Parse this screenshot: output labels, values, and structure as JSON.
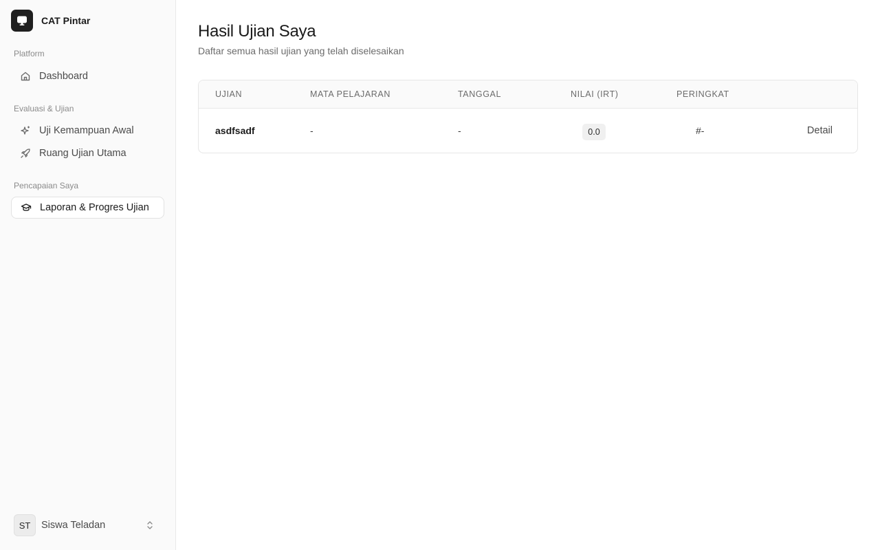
{
  "app": {
    "name": "CAT Pintar"
  },
  "sidebar": {
    "sections": [
      {
        "label": "Platform"
      },
      {
        "label": "Evaluasi & Ujian"
      },
      {
        "label": "Pencapaian Saya"
      }
    ],
    "items": [
      {
        "label": "Dashboard",
        "icon": "home-icon"
      },
      {
        "label": "Uji Kemampuan Awal",
        "icon": "sparkles-icon"
      },
      {
        "label": "Ruang Ujian Utama",
        "icon": "rocket-icon"
      },
      {
        "label": "Laporan & Progres Ujian",
        "icon": "graduation-cap-icon",
        "active": true
      }
    ],
    "user": {
      "initials": "ST",
      "name": "Siswa Teladan"
    }
  },
  "main": {
    "title": "Hasil Ujian Saya",
    "subtitle": "Daftar semua hasil ujian yang telah diselesaikan",
    "table": {
      "headers": [
        "UJIAN",
        "MATA PELAJARAN",
        "TANGGAL",
        "NILAI (IRT)",
        "PERINGKAT"
      ],
      "rows": [
        {
          "ujian": "asdfsadf",
          "mapel": "-",
          "tanggal": "-",
          "nilai": "0.0",
          "peringkat": "#-",
          "action": "Detail"
        }
      ]
    }
  }
}
